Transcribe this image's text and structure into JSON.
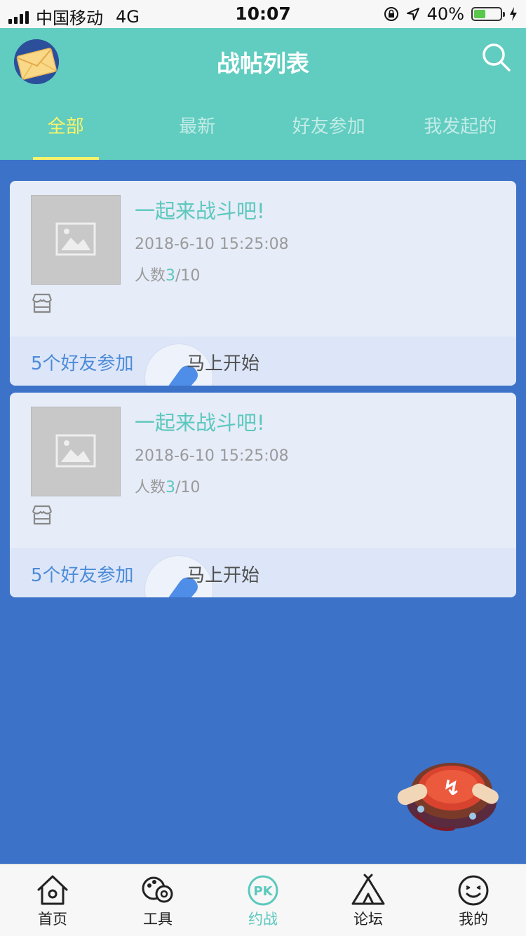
{
  "status_bar": {
    "carrier": "中国移动",
    "network": "4G",
    "time": "10:07",
    "battery": "40%"
  },
  "header": {
    "title": "战帖列表",
    "icons": {
      "avatar": "envelope-avatar",
      "search": "search-icon"
    }
  },
  "tabs": [
    {
      "label": "全部",
      "active": true
    },
    {
      "label": "最新",
      "active": false
    },
    {
      "label": "好友参加",
      "active": false
    },
    {
      "label": "我发起的",
      "active": false
    }
  ],
  "posts": [
    {
      "title": "一起来战斗吧!",
      "time": "2018-6-10 15:25:08",
      "count_prefix": "人数",
      "count_current": "3",
      "count_total": "/10",
      "friends": "5个好友参加",
      "action": "马上开始"
    },
    {
      "title": "一起来战斗吧!",
      "time": "2018-6-10 15:25:08",
      "count_prefix": "人数",
      "count_current": "3",
      "count_total": "/10",
      "friends": "5个好友参加",
      "action": "马上开始"
    }
  ],
  "tabbar": [
    {
      "label": "首页",
      "icon": "home-icon",
      "active": false
    },
    {
      "label": "工具",
      "icon": "tools-icon",
      "active": false
    },
    {
      "label": "约战",
      "icon": "pk-icon",
      "active": true
    },
    {
      "label": "论坛",
      "icon": "tent-icon",
      "active": false
    },
    {
      "label": "我的",
      "icon": "smiley-icon",
      "active": false
    }
  ],
  "colors": {
    "header": "#61ccc0",
    "background": "#3c72c7",
    "accent": "#5cc8bd",
    "active_tab": "#f8f36a",
    "friends_text": "#4c8bd8"
  }
}
